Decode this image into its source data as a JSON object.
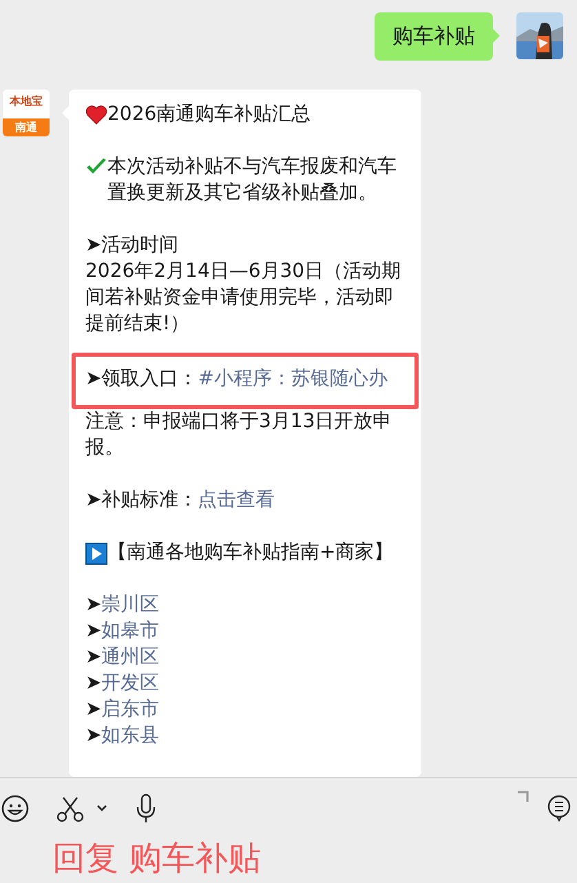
{
  "sent_message": {
    "text": "购车补贴"
  },
  "sender": {
    "logo_text": "本地宝",
    "city": "南通"
  },
  "message": {
    "paragraphs": [
      {
        "kind": "heart",
        "lines": [
          "2026南通购车补贴汇总"
        ],
        "highlighted": false
      },
      {
        "kind": "check",
        "lines": [
          "本次活动补贴不与汽车报废和汽车置换更新及其它省级补贴叠加。"
        ],
        "highlighted": false
      },
      {
        "kind": "plain",
        "lines": [
          "➤活动时间",
          "2026年2月14日—6月30日（活动期间若补贴资金申请使用完毕，活动即提前结束!）"
        ],
        "highlighted": false
      },
      {
        "kind": "plain",
        "lines": [
          "➤领取入口："
        ],
        "link": "#小程序：苏银随心办",
        "highlighted": true
      },
      {
        "kind": "plain",
        "lines": [
          "注意：申报端口将于3月13日开放申报。"
        ],
        "highlighted": false
      },
      {
        "kind": "plain",
        "lines": [
          "➤补贴标准："
        ],
        "link": "点击查看",
        "highlighted": false
      },
      {
        "kind": "play",
        "lines": [
          "【南通各地购车补贴指南+商家】"
        ],
        "highlighted": false
      }
    ],
    "district_links": [
      {
        "arrow": "➤",
        "label": "崇川区"
      },
      {
        "arrow": "➤",
        "label": "如皋市"
      },
      {
        "arrow": "➤",
        "label": "通州区"
      },
      {
        "arrow": "➤",
        "label": "开发区"
      },
      {
        "arrow": "➤",
        "label": "启东市"
      },
      {
        "arrow": "➤",
        "label": "如东县"
      }
    ]
  },
  "reply_caption": "回复 购车补贴"
}
